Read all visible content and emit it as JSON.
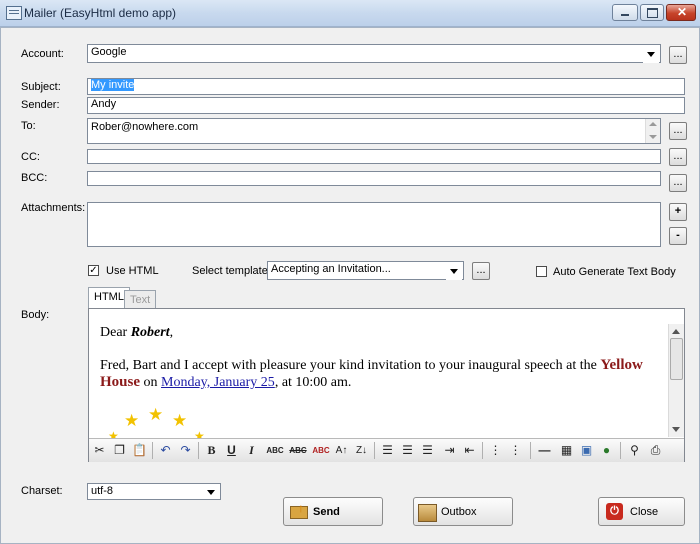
{
  "window": {
    "title": "Mailer (EasyHtml demo app)",
    "minimize_label": "minimize",
    "maximize_label": "maximize",
    "close_label": "close"
  },
  "form": {
    "account_label": "Account:",
    "account_value": "Google",
    "subject_label": "Subject:",
    "subject_value": "My invite",
    "sender_label": "Sender:",
    "sender_value": "Andy",
    "to_label": "To:",
    "to_value": "Rober@nowhere.com",
    "cc_label": "CC:",
    "cc_value": "",
    "bcc_label": "BCC:",
    "bcc_value": "",
    "attachments_label": "Attachments:",
    "browse_label": "...",
    "add_label": "+",
    "remove_label": "-"
  },
  "options": {
    "use_html_label": "Use HTML",
    "use_html_checked": true,
    "template_label": "Select template:",
    "template_value": "Accepting an Invitation...",
    "auto_generate_label": "Auto Generate Text Body",
    "auto_generate_checked": false
  },
  "body": {
    "label": "Body:",
    "tabs": [
      {
        "label": "HTML",
        "active": true
      },
      {
        "label": "Text",
        "active": false
      }
    ],
    "greeting": "Dear ",
    "name": "Robert",
    "greeting_end": ",",
    "line1": "Fred, Bart and I accept with pleasure your kind invitation to your inaugural speech at the ",
    "venue": "Yellow House",
    "on": " on ",
    "date": "Monday, January 25",
    "time": ", at 10:00 am."
  },
  "toolbar_icons": [
    "cut-icon",
    "copy-icon",
    "paste-icon",
    "undo-icon",
    "redo-icon",
    "bold-icon",
    "underline-icon",
    "italic-icon",
    "spellcheck-icon",
    "strikethrough-icon",
    "spellcheck-red-icon",
    "sort-asc-icon",
    "sort-desc-icon",
    "align-left-icon",
    "align-center-icon",
    "align-right-icon",
    "indent-icon",
    "outdent-icon",
    "bullet-list-icon",
    "numbered-list-icon",
    "horizontal-rule-icon",
    "table-icon",
    "image-icon",
    "globe-link-icon",
    "find-icon",
    "print-icon"
  ],
  "footer": {
    "charset_label": "Charset:",
    "charset_value": "utf-8",
    "send_label": "Send",
    "outbox_label": "Outbox",
    "close_label": "Close"
  },
  "colors": {
    "accent": "#8b1a1a",
    "link": "#1a1aa6",
    "star": "#f2c200"
  }
}
